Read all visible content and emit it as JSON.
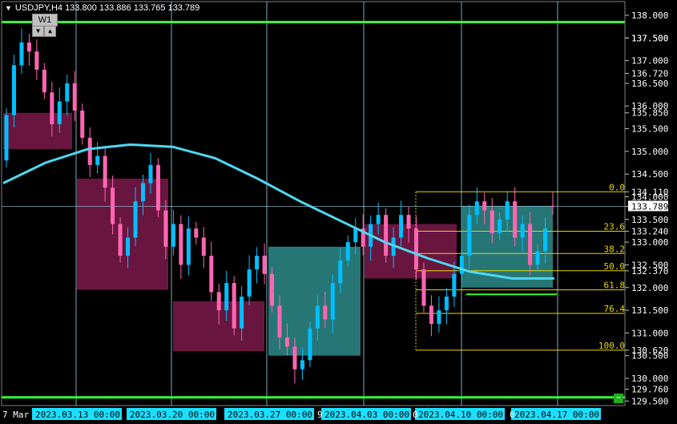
{
  "header": {
    "symbol_line": "USDJPY,H4  133.800 133.886 133.765 133.789",
    "timeframe_badge": "W1",
    "expand_up_icon": "triangle-up-icon",
    "expand_down_icon": "triangle-down-icon"
  },
  "colors": {
    "background": "#000000",
    "bull_candle": "#00bfff",
    "bear_candle": "#ff66b2",
    "moving_average": "#4fd8f0",
    "fibo": "#e6d600",
    "green_lines": "#33ff33",
    "demand_zone": "#2e8b8b",
    "supply_zone": "#7a1a4a",
    "price_tag_bg": "#ffffff",
    "date_tag_bg": "#19e0ff"
  },
  "price_axis": {
    "labels": [
      "138.000",
      "137.500",
      "137.500",
      "137.000",
      "136.720",
      "136.500",
      "136.000",
      "135.850",
      "135.500",
      "135.000",
      "134.500",
      "134.110",
      "134.000",
      "133.789",
      "133.500",
      "133.240",
      "133.000",
      "132.500",
      "132.370",
      "132.000",
      "131.500",
      "131.000",
      "130.620",
      "130.500",
      "130.000",
      "129.760",
      "129.500"
    ],
    "current_price": "133.789"
  },
  "time_axis": {
    "partial_left": "7 Mar 2",
    "labels": [
      "2023.03.13 00:00",
      "2023.03.20 00:00",
      "2023.03.27 00:00",
      "2023.04.03 00:00",
      "2023.04.10 00:00",
      "2023.04.17 00:00"
    ],
    "fragments": [
      "9",
      "0",
      "0"
    ]
  },
  "fibo": {
    "levels": [
      "0.0",
      "23.6",
      "38.2",
      "50.0",
      "61.8",
      "76.4",
      "100.0"
    ]
  },
  "corner_button": "−",
  "chart_data": {
    "type": "candlestick",
    "title": "USDJPY,H4",
    "ohlc_current": {
      "open": 133.8,
      "high": 133.886,
      "low": 133.765,
      "close": 133.789
    },
    "ylim": [
      129.4,
      138.3
    ],
    "x_dates": [
      "2023.03.13",
      "2023.03.20",
      "2023.03.27",
      "2023.04.03",
      "2023.04.10",
      "2023.04.17"
    ],
    "fibo_levels": [
      {
        "ratio": "0.0",
        "price": 134.11
      },
      {
        "ratio": "23.6",
        "price": 133.24
      },
      {
        "ratio": "38.2",
        "price": 132.75
      },
      {
        "ratio": "50.0",
        "price": 132.37
      },
      {
        "ratio": "61.8",
        "price": 131.95
      },
      {
        "ratio": "76.4",
        "price": 131.43
      },
      {
        "ratio": "100.0",
        "price": 130.62
      }
    ],
    "green_lines": [
      137.85,
      129.58
    ],
    "closes": [
      135.8,
      136.9,
      137.4,
      137.2,
      136.8,
      136.3,
      135.6,
      136.1,
      136.5,
      135.9,
      135.3,
      134.7,
      134.9,
      134.2,
      133.4,
      132.7,
      133.1,
      133.9,
      134.3,
      134.7,
      133.7,
      132.9,
      133.4,
      132.5,
      133.3,
      133.1,
      132.7,
      131.9,
      131.5,
      132.1,
      131.1,
      131.8,
      132.4,
      132.7,
      132.3,
      131.6,
      130.9,
      130.7,
      130.2,
      130.4,
      131.1,
      131.6,
      131.3,
      132.1,
      132.6,
      133.0,
      133.3,
      132.9,
      133.4,
      133.6,
      132.7,
      133.1,
      133.6,
      133.3,
      132.4,
      131.6,
      131.2,
      131.5,
      131.8,
      132.3,
      132.7,
      133.6,
      133.9,
      133.7,
      133.2,
      133.5,
      133.9,
      133.1,
      133.4,
      132.5,
      132.8,
      133.3,
      133.789
    ],
    "moving_average": [
      134.3,
      134.75,
      135.05,
      135.15,
      135.1,
      134.85,
      134.4,
      133.9,
      133.45,
      133.0,
      132.65,
      132.35,
      132.2,
      132.2
    ]
  }
}
